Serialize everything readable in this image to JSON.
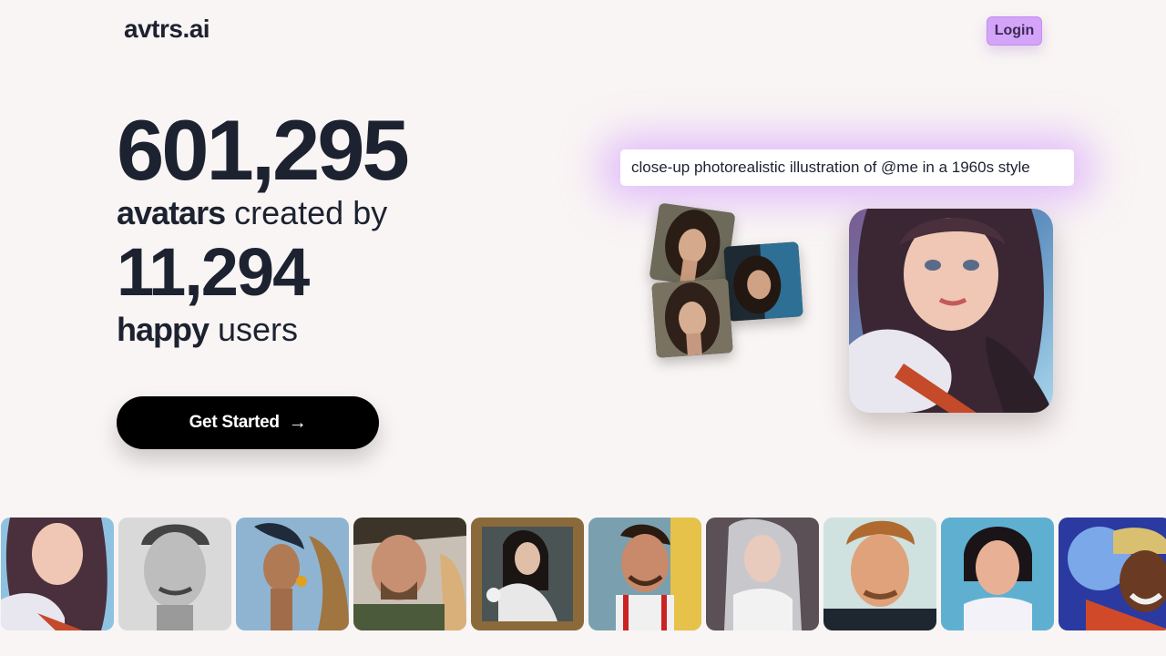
{
  "header": {
    "logo": "avtrs.ai",
    "login_label": "Login"
  },
  "stats": {
    "avatars_count": "601,295",
    "avatars_bold": "avatars",
    "avatars_rest": " created by",
    "users_count": "11,294",
    "users_bold": "happy",
    "users_rest": " users"
  },
  "cta": {
    "label": "Get Started",
    "icon": "arrow-right-icon"
  },
  "prompt": {
    "text": "close-up photorealistic illustration of @me in a 1960s style"
  },
  "colors": {
    "background": "#f9f5f4",
    "text": "#1d2230",
    "login_bg": "#d4a4f9",
    "cta_bg": "#000000",
    "prompt_glow": "#cd8cff"
  },
  "gallery": {
    "items": [
      "avatar-woman-fur-coat",
      "avatar-man-pencil-sketch",
      "avatar-woman-earrings-camel",
      "avatar-man-hat-camel",
      "avatar-woman-framed-painting",
      "avatar-man-city-street",
      "avatar-woman-silver-hair",
      "avatar-man-cartoon",
      "avatar-girl-cartoon",
      "avatar-man-colorful-hat"
    ]
  }
}
